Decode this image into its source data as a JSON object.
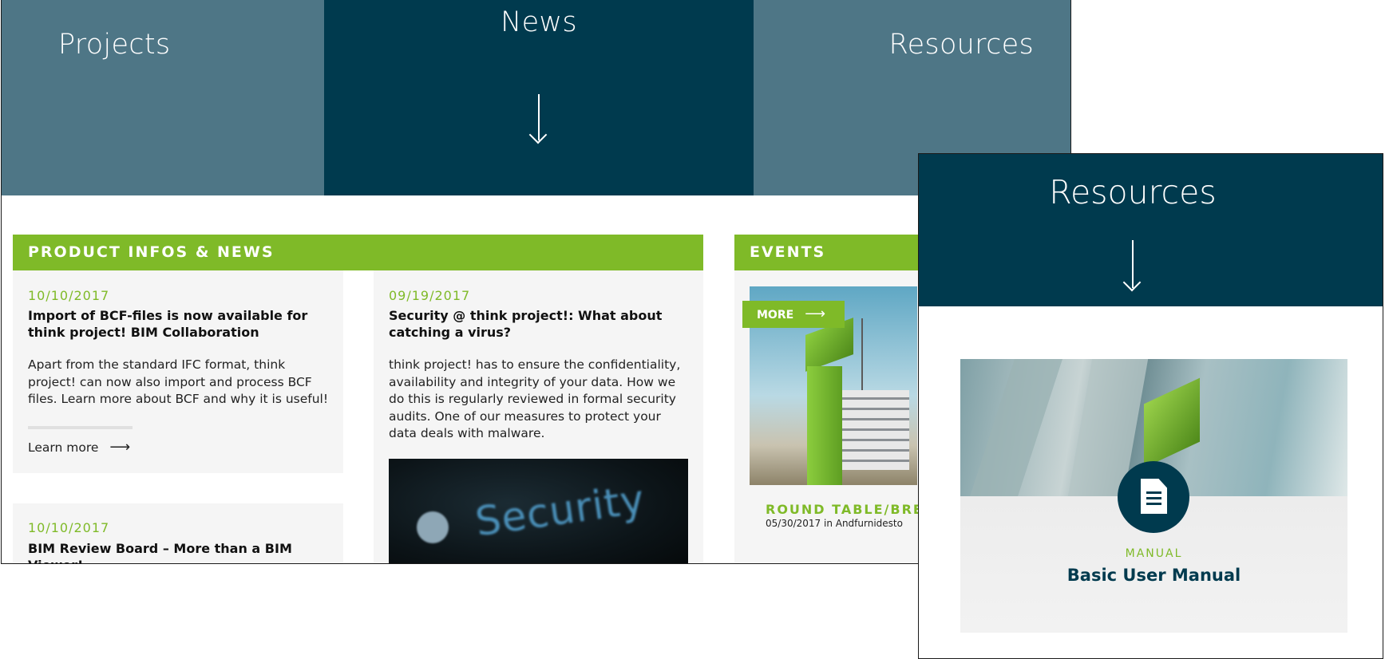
{
  "nav": {
    "tabs": [
      {
        "label": "Projects"
      },
      {
        "label": "News"
      },
      {
        "label": "Resources"
      }
    ]
  },
  "product": {
    "header": "PRODUCT INFOS & NEWS",
    "cards": [
      {
        "date": "10/10/2017",
        "title": "Import of BCF-files is now available for think project! BIM Collaboration",
        "body": "Apart from the standard IFC format, think project! can now also import and process BCF files. Learn more about BCF and why it is useful!",
        "link_label": "Learn more",
        "link_icon": "⟶"
      },
      {
        "date": "09/19/2017",
        "title": "Security @ think project!: What about catching a virus?",
        "body": "think project! has to ensure the confidentiality, availability and integrity of your data. How we do this is regularly reviewed in formal security audits. One of our measures to protect your data deals with malware.",
        "image_text": "Security"
      },
      {
        "date": "10/10/2017",
        "title": "BIM Review Board – More than a BIM Viewer!"
      }
    ]
  },
  "events": {
    "header": "EVENTS",
    "more_label": "MORE",
    "more_icon": "⟶",
    "item": {
      "title": "ROUND TABLE/BREAK",
      "meta": "05/30/2017 in Andfurnidesto"
    }
  },
  "resources_panel": {
    "title": "Resources",
    "card": {
      "kicker": "MANUAL",
      "title": "Basic User Manual",
      "icon": "document-icon"
    }
  },
  "colors": {
    "dark_teal": "#003a4e",
    "muted_teal": "#4e7686",
    "green": "#7fba28"
  }
}
